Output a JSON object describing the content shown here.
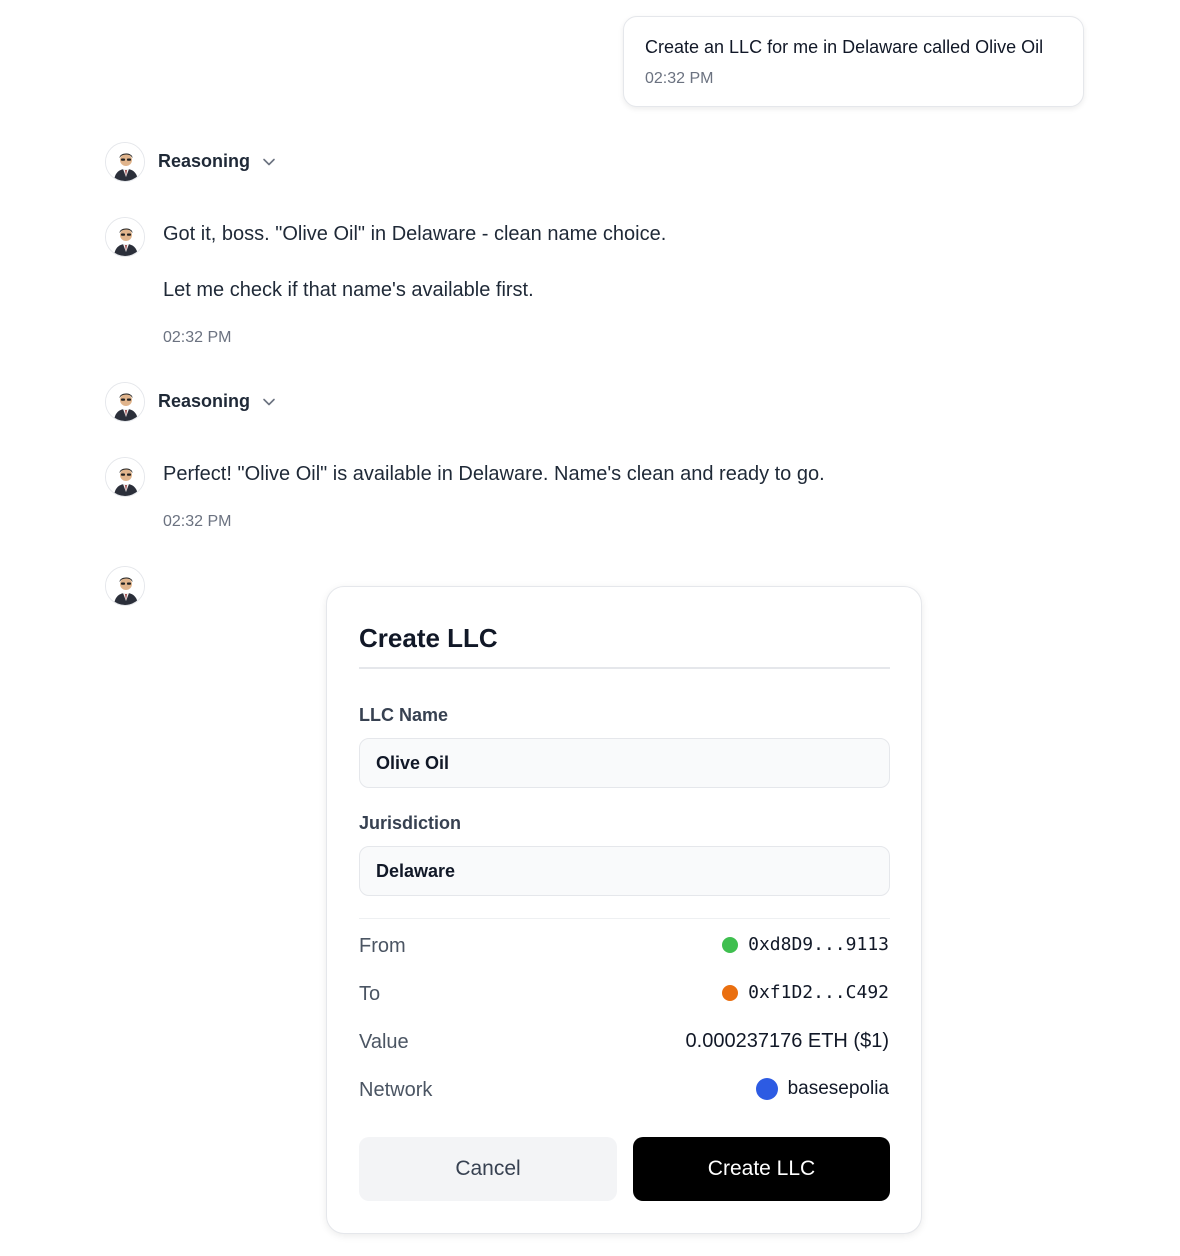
{
  "user_message": {
    "text": "Create an LLC for me in Delaware called Olive Oil",
    "time": "02:32 PM"
  },
  "reasoning_label": "Reasoning",
  "assistant_messages": [
    {
      "paragraphs": [
        "Got it, boss. \"Olive Oil\" in Delaware - clean name choice.",
        "Let me check if that name's available first."
      ],
      "time": "02:32 PM"
    },
    {
      "paragraphs": [
        "Perfect! \"Olive Oil\" is available in Delaware. Name's clean and ready to go."
      ],
      "time": "02:32 PM"
    }
  ],
  "card": {
    "title": "Create LLC",
    "llc_name_label": "LLC Name",
    "llc_name_value": "Olive Oil",
    "jurisdiction_label": "Jurisdiction",
    "jurisdiction_value": "Delaware",
    "rows": {
      "from": {
        "label": "From",
        "value": "0xd8D9...9113",
        "color": "#3fbf4f"
      },
      "to": {
        "label": "To",
        "value": "0xf1D2...C492",
        "color": "#ea6f10"
      },
      "value": {
        "label": "Value",
        "value": "0.000237176 ETH ($1)"
      },
      "network": {
        "label": "Network",
        "value": "basesepolia",
        "color": "#2d5be3"
      }
    },
    "cancel_label": "Cancel",
    "create_label": "Create LLC"
  },
  "icons": {
    "avatar": "agent-avatar-icon",
    "chevron": "chevron-down-icon"
  }
}
